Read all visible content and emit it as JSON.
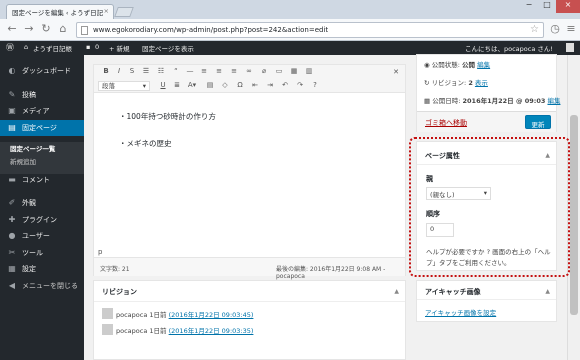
{
  "browser": {
    "tab_title": "固定ページを編集 ‹ ようず日記",
    "url": "www.egokorodiary.com/wp-admin/post.php?post=242&action=edit"
  },
  "wpbar": {
    "site_name": "ようず日記帳",
    "comments_count": "0",
    "new_label": "+ 新規",
    "view_page": "固定ページを表示",
    "greeting": "こんにちは、pocapoca さん!"
  },
  "sidebar": {
    "items": [
      {
        "label": "ダッシュボード",
        "icon": "dashboard-icon"
      },
      {
        "label": "投稿",
        "icon": "pin-icon"
      },
      {
        "label": "メディア",
        "icon": "media-icon"
      },
      {
        "label": "固定ページ",
        "icon": "page-icon"
      },
      {
        "label": "固定ページ一覧"
      },
      {
        "label": "新規追加"
      },
      {
        "label": "コメント",
        "icon": "comment-icon"
      },
      {
        "label": "外観",
        "icon": "brush-icon"
      },
      {
        "label": "プラグイン",
        "icon": "plugin-icon"
      },
      {
        "label": "ユーザー",
        "icon": "user-icon"
      },
      {
        "label": "ツール",
        "icon": "wrench-icon"
      },
      {
        "label": "設定",
        "icon": "settings-icon"
      },
      {
        "label": "メニューを閉じる",
        "icon": "collapse-icon"
      }
    ]
  },
  "editor": {
    "format_select": "段落",
    "content_line1": "・100年持つ砂時計の作り方",
    "content_line2": "・メギネの歴史",
    "path": "p",
    "word_count": "文字数: 21",
    "last_edited": "最後の編集: 2016年1月22日 9:08 AM - pocapoca"
  },
  "revisions": {
    "title": "リビジョン",
    "rows": [
      {
        "author": "pocapoca",
        "ago": "1日前",
        "date": "(2016年1月22日 09:03:45)"
      },
      {
        "author": "pocapoca",
        "ago": "1日前",
        "date": "(2016年1月22日 09:03:35)"
      }
    ]
  },
  "publish": {
    "status_label": "公開状態:",
    "status_value": "公開",
    "edit_link": "編集",
    "revisions_label": "リビジョン:",
    "revisions_count": "2",
    "revisions_link": "表示",
    "date_label": "公開日時:",
    "date_value": "2016年1月22日 @ 09:03",
    "trash_link": "ゴミ箱へ移動",
    "update_button": "更新"
  },
  "page_attributes": {
    "title": "ページ属性",
    "parent_label": "親",
    "parent_value": "(親なし)",
    "order_label": "順序",
    "order_value": "0",
    "help_line1": "ヘルプが必要ですか ? 画面の右上の「ヘル",
    "help_line2": "プ」タブをご利用ください。"
  },
  "featured_image": {
    "title": "アイキャッチ画像",
    "set_link": "アイキャッチ画像を設定"
  },
  "colors": {
    "accent": "#0073aa",
    "admin_dark": "#23282d",
    "highlight": "#c41010"
  }
}
